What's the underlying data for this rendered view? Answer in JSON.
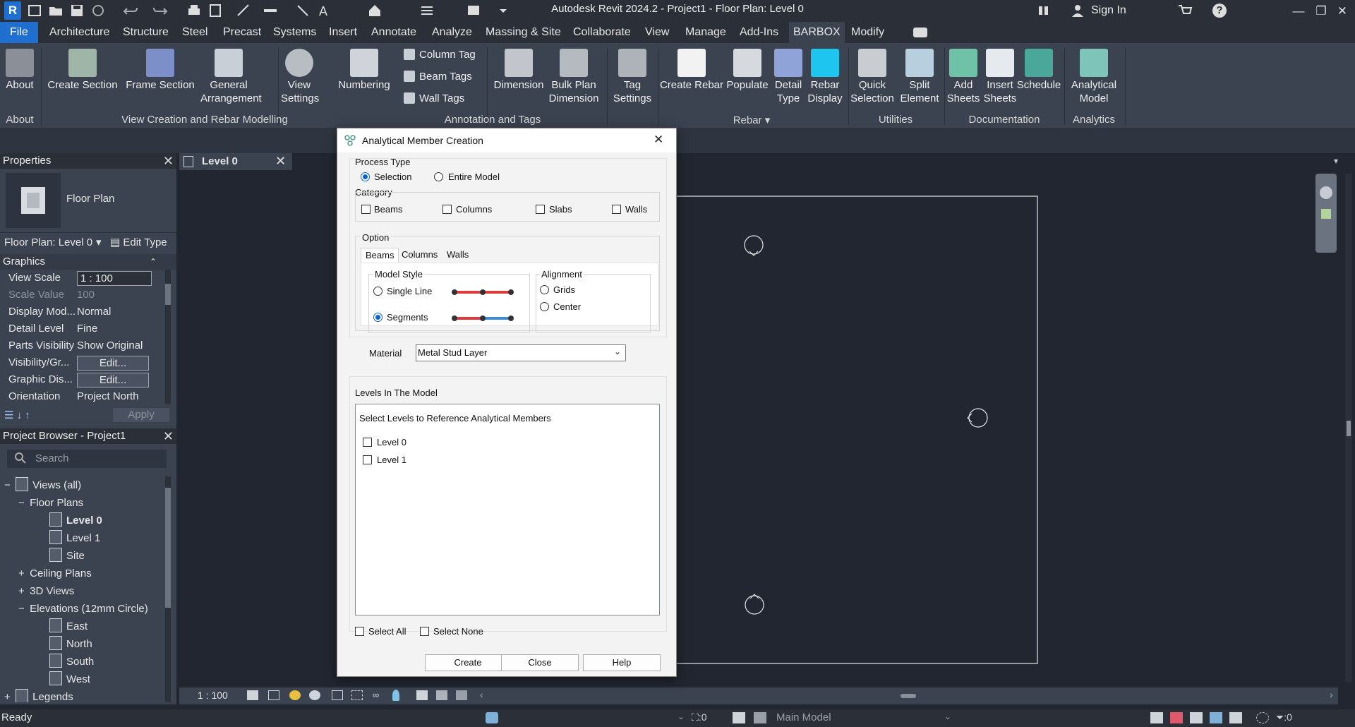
{
  "titlebar": {
    "app_letter": "R",
    "title": "Autodesk Revit 2024.2 - Project1 - Floor Plan: Level 0",
    "sign_in": "Sign In",
    "help": "?",
    "minimize": "—",
    "restore": "❐",
    "close": "✕"
  },
  "ribbon_tabs": [
    "File",
    "Architecture",
    "Structure",
    "Steel",
    "Precast",
    "Systems",
    "Insert",
    "Annotate",
    "Analyze",
    "Massing & Site",
    "Collaborate",
    "View",
    "Manage",
    "Add-Ins",
    "BARBOX",
    "Modify"
  ],
  "ribbon": {
    "about": {
      "label": "About",
      "panel": "About"
    },
    "view_creation": {
      "panel": "View Creation and Rebar Modelling",
      "create_section": "Create Section",
      "frame_section": "Frame Section",
      "general_arrangement": "General Arrangement",
      "view_settings": "View Settings",
      "numbering": "Numbering"
    },
    "annotation": {
      "panel": "Annotation and Tags",
      "column_tag": "Column Tag",
      "beam_tags": "Beam Tags",
      "wall_tags": "Wall Tags",
      "dimension": "Dimension",
      "bulk_plan_dimension": "Bulk Plan Dimension",
      "tag_settings": "Tag Settings"
    },
    "rebar": {
      "panel": "Rebar",
      "create_rebar": "Create Rebar",
      "populate": "Populate",
      "detail_type": "Detail Type",
      "rebar_display": "Rebar Display"
    },
    "utilities": {
      "panel": "Utilities",
      "quick_selection": "Quick Selection",
      "split_element": "Split Element"
    },
    "documentation": {
      "panel": "Documentation",
      "add_sheets": "Add Sheets",
      "insert_sheets": "Insert Sheets",
      "schedule": "Schedule"
    },
    "analytics": {
      "panel": "Analytics",
      "analytical_model": "Analytical Model"
    }
  },
  "properties": {
    "title": "Properties",
    "type_name": "Floor Plan",
    "selector": "Floor Plan: Level 0",
    "edit_type": "Edit Type",
    "section": "Graphics",
    "rows": [
      {
        "k": "View Scale",
        "v": "1 : 100"
      },
      {
        "k": "Scale Value",
        "v": "100"
      },
      {
        "k": "Display Mod...",
        "v": "Normal"
      },
      {
        "k": "Detail Level",
        "v": "Fine"
      },
      {
        "k": "Parts Visibility",
        "v": "Show Original"
      },
      {
        "k": "Visibility/Gr...",
        "v": "Edit..."
      },
      {
        "k": "Graphic Dis...",
        "v": "Edit..."
      },
      {
        "k": "Orientation",
        "v": "Project North"
      }
    ],
    "apply": "Apply"
  },
  "browser": {
    "title": "Project Browser - Project1",
    "search_placeholder": "Search",
    "items": [
      {
        "label": "Views (all)",
        "level": 0,
        "toggle": "−"
      },
      {
        "label": "Floor Plans",
        "level": 1,
        "toggle": "−"
      },
      {
        "label": "Level 0",
        "level": 2,
        "bold": true
      },
      {
        "label": "Level 1",
        "level": 2
      },
      {
        "label": "Site",
        "level": 2
      },
      {
        "label": "Ceiling Plans",
        "level": 1,
        "toggle": "+"
      },
      {
        "label": "3D Views",
        "level": 1,
        "toggle": "+"
      },
      {
        "label": "Elevations (12mm Circle)",
        "level": 1,
        "toggle": "−"
      },
      {
        "label": "East",
        "level": 2
      },
      {
        "label": "North",
        "level": 2
      },
      {
        "label": "South",
        "level": 2
      },
      {
        "label": "West",
        "level": 2
      },
      {
        "label": "Legends",
        "level": 0,
        "toggle": "+"
      }
    ]
  },
  "view_tab": {
    "label": "Level 0"
  },
  "view_bar": {
    "scale": "1 : 100"
  },
  "dialog": {
    "title": "Analytical Member Creation",
    "process_type": {
      "label": "Process Type",
      "options": [
        "Selection",
        "Entire Model"
      ],
      "selected": "Selection"
    },
    "category": {
      "label": "Category",
      "options": [
        "Beams",
        "Columns",
        "Slabs",
        "Walls"
      ]
    },
    "option": {
      "label": "Option",
      "tabs": [
        "Beams",
        "Columns",
        "Walls"
      ],
      "active_tab": "Beams",
      "model_style": {
        "label": "Model Style",
        "options": [
          "Single Line",
          "Segments"
        ],
        "selected": "Segments"
      },
      "alignment": {
        "label": "Alignment",
        "options": [
          "Grids",
          "Center"
        ]
      },
      "material_label": "Material",
      "material_value": "Metal Stud Layer"
    },
    "levels": {
      "label": "Levels In The Model",
      "hint": "Select Levels to Reference Analytical Members",
      "items": [
        "Level 0",
        "Level 1"
      ]
    },
    "select_all": "Select All",
    "select_none": "Select None",
    "buttons": {
      "create": "Create",
      "close": "Close",
      "help": "Help"
    }
  },
  "statusbar": {
    "status": "Ready",
    "sel_count": ":0",
    "model": "Main Model",
    "filter_count": ":0"
  },
  "colors": {
    "accent": "#1f6fd1",
    "ribbon": "#3b4250",
    "canvas": "#212630",
    "radio_on": "#0a64d2",
    "seg_red": "#e0393b",
    "seg_blue": "#3a8fd8"
  }
}
